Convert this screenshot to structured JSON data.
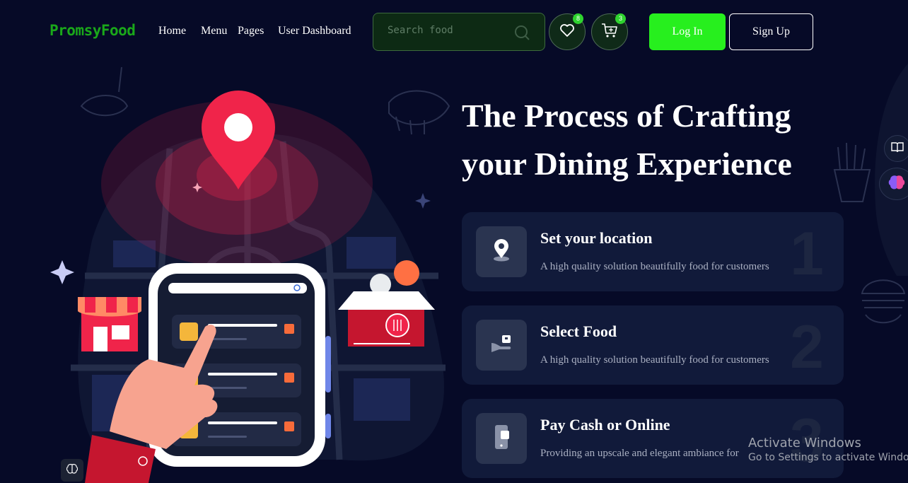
{
  "brand": {
    "logo": "PromsyFood"
  },
  "nav": {
    "home": "Home",
    "menu": "Menu",
    "pages": "Pages",
    "dashboard": "User Dashboard"
  },
  "search": {
    "placeholder": "Search food"
  },
  "wishlist": {
    "count": "8"
  },
  "cart": {
    "count": "3"
  },
  "auth": {
    "login": "Log In",
    "signup": "Sign Up"
  },
  "hero": {
    "title_line1": "The Process of Crafting",
    "title_line2": "your Dining Experience"
  },
  "steps": [
    {
      "title": "Set your location",
      "desc": "A high quality solution beautifully food for customers",
      "num": "1",
      "icon": "location-pin-icon"
    },
    {
      "title": "Select Food",
      "desc": "A high quality solution beautifully food for customers",
      "num": "2",
      "icon": "serving-hand-icon"
    },
    {
      "title": "Pay Cash or Online",
      "desc": "Providing an upscale and elegant ambiance for",
      "num": "3",
      "icon": "mobile-payment-icon"
    }
  ],
  "watermark": {
    "line1": "Activate Windows",
    "line2": "Go to Settings to activate Windows."
  },
  "colors": {
    "background": "#060a27",
    "brand_green": "#1aa81a",
    "login_green": "#27ef1e",
    "pin_red": "#f0244a",
    "card_bg": "#111a3a"
  }
}
